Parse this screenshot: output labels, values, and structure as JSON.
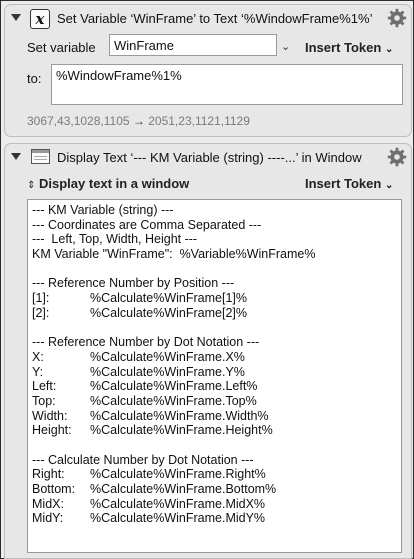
{
  "action1": {
    "title": "Set Variable ‘WinFrame’ to Text ‘%WindowFrame%1%’",
    "set_variable_label": "Set variable",
    "variable_name": "WinFrame",
    "insert_token_label": "Insert Token",
    "to_label": "to:",
    "to_value": "%WindowFrame%1%",
    "result_before": "3067,43,1028,1105",
    "arrow": "→",
    "result_after": "2051,23,1121,1129"
  },
  "action2": {
    "title": "Display Text ‘--- KM Variable (string) ----...’ in Window",
    "mode_label": "Display text in a window",
    "insert_token_label": "Insert Token",
    "text_lines": [
      {
        "a": "--- KM Variable (string) ---",
        "b": ""
      },
      {
        "a": "--- Coordinates are Comma Separated ---",
        "b": ""
      },
      {
        "a": "---  Left, Top, Width, Height ---",
        "b": ""
      },
      {
        "a": "KM Variable \"WinFrame\":  %Variable%WinFrame%",
        "b": ""
      },
      {
        "a": "",
        "b": ""
      },
      {
        "a": "--- Reference Number by Position ---",
        "b": ""
      },
      {
        "a": "[1]:",
        "b": "%Calculate%WinFrame[1]%"
      },
      {
        "a": "[2]:",
        "b": "%Calculate%WinFrame[2]%"
      },
      {
        "a": "",
        "b": ""
      },
      {
        "a": "--- Reference Number by Dot Notation ---",
        "b": ""
      },
      {
        "a": "X:",
        "b": "%Calculate%WinFrame.X%"
      },
      {
        "a": "Y:",
        "b": "%Calculate%WinFrame.Y%"
      },
      {
        "a": "Left:",
        "b": "%Calculate%WinFrame.Left%"
      },
      {
        "a": "Top:",
        "b": "%Calculate%WinFrame.Top%"
      },
      {
        "a": "Width:",
        "b": "%Calculate%WinFrame.Width%"
      },
      {
        "a": "Height:",
        "b": "%Calculate%WinFrame.Height%"
      },
      {
        "a": "",
        "b": ""
      },
      {
        "a": "--- Calculate Number by Dot Notation ---",
        "b": ""
      },
      {
        "a": "Right:",
        "b": "%Calculate%WinFrame.Right%"
      },
      {
        "a": "Bottom:",
        "b": "%Calculate%WinFrame.Bottom%"
      },
      {
        "a": "MidX:",
        "b": "%Calculate%WinFrame.MidX%"
      },
      {
        "a": "MidY:",
        "b": "%Calculate%WinFrame.MidY%"
      }
    ]
  },
  "icons": {
    "disclosure": "disclosure-triangle-icon",
    "set_variable": "x-variable-icon",
    "display_text": "window-icon",
    "gear": "gear-icon",
    "chevron": "chevron-down-icon",
    "updown": "up-down-chevron-icon"
  }
}
